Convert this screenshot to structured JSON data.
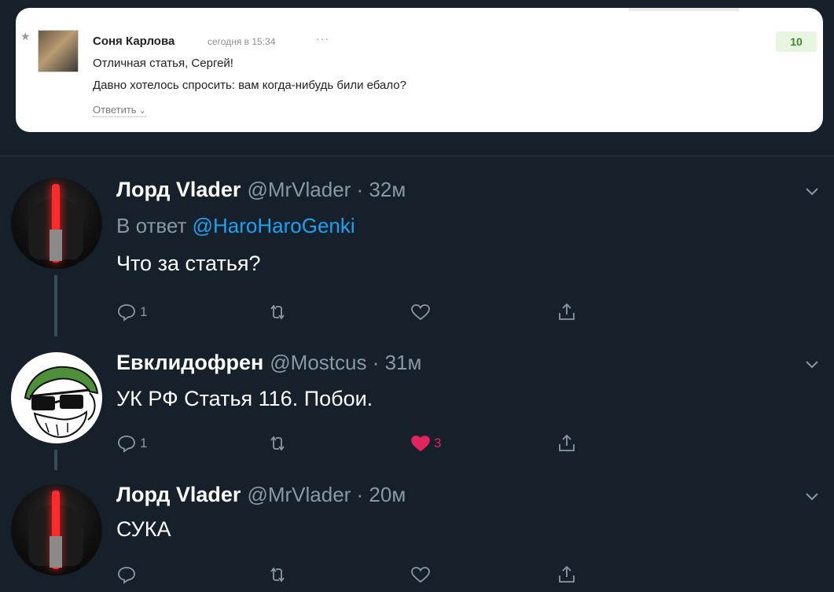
{
  "embed": {
    "author": "Соня Карлова",
    "time": "сегодня в 15:34",
    "dots": "···",
    "score": "10",
    "line1": "Отличная статья, Сергей!",
    "line2": "Давно хотелось спросить: вам когда-нибудь били ебало?",
    "reply_label": "Ответить"
  },
  "tweets": [
    {
      "name": "Лорд Vlader",
      "handle": "@MrVlader · 32м",
      "reply_prefix": "В ответ",
      "reply_mention": "@HaroHaroGenki",
      "text": "Что за статья?",
      "replies": "1",
      "retweets": "",
      "likes": ""
    },
    {
      "name": "Евклидофрен",
      "handle": "@Mostcus · 31м",
      "text": "УК РФ Статья 116. Побои.",
      "replies": "1",
      "retweets": "",
      "likes": "3",
      "liked": true
    },
    {
      "name": "Лорд Vlader",
      "handle": "@MrVlader · 20м",
      "text": "СУКА",
      "replies": "",
      "retweets": "",
      "likes": ""
    }
  ],
  "colors": {
    "background": "#15202b",
    "secondary_text": "#8899a6",
    "link": "#1da1f2",
    "like_active": "#e0245e",
    "score_green": "#3b8a2e"
  },
  "icons": [
    "chevron-down-icon",
    "reply-icon",
    "retweet-icon",
    "heart-icon",
    "share-icon"
  ]
}
